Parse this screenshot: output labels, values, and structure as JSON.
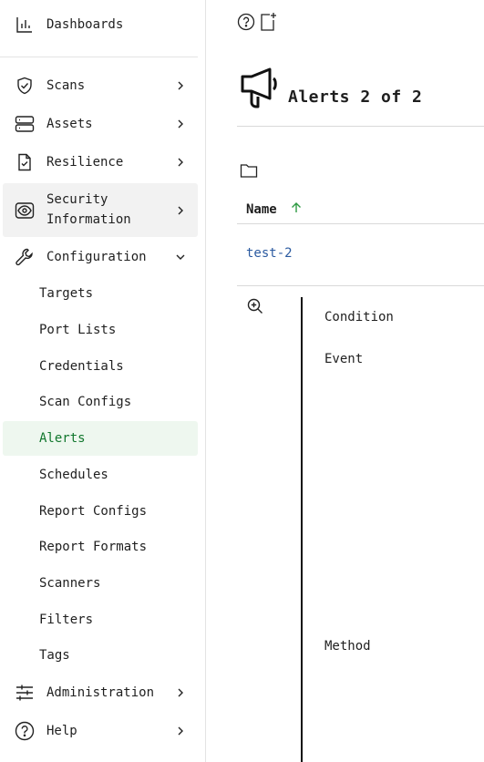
{
  "sidebar": {
    "dashboards": "Dashboards",
    "scans": "Scans",
    "assets": "Assets",
    "resilience": "Resilience",
    "security_information_1": "Security",
    "security_information_2": "Information",
    "configuration": "Configuration",
    "configuration_items": [
      "Targets",
      "Port Lists",
      "Credentials",
      "Scan Configs",
      "Alerts",
      "Schedules",
      "Report Configs",
      "Report Formats",
      "Scanners",
      "Filters",
      "Tags"
    ],
    "administration": "Administration",
    "help": "Help"
  },
  "main": {
    "title": "Alerts 2 of 2",
    "table_header_name": "Name",
    "row_name": "test-2",
    "details": {
      "condition": "Condition",
      "event": "Event",
      "method": "Method"
    }
  },
  "colors": {
    "active_text": "#11772d",
    "active_bg": "#eef7ef",
    "link": "#2b5aa0",
    "sort_arrow": "#2e9a43"
  }
}
